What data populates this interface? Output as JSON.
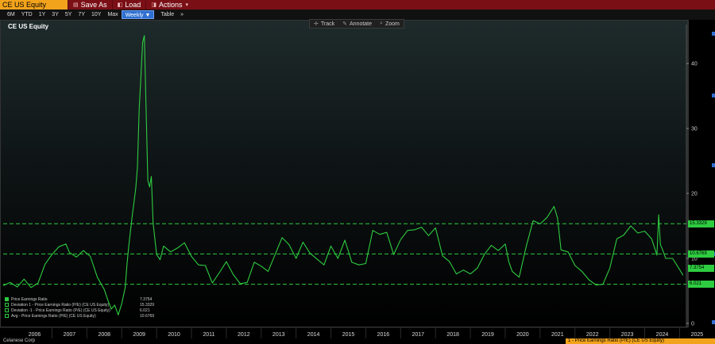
{
  "topbar": {
    "ticker": "CE US Equity",
    "save_as": "Save As",
    "load": "Load",
    "actions": "Actions"
  },
  "rangebar": {
    "buttons": [
      "6M",
      "YTD",
      "1Y",
      "3Y",
      "5Y",
      "7Y",
      "10Y",
      "Max"
    ],
    "periodicity": "Weekly ▼",
    "table": "Table",
    "more": "»"
  },
  "chart_tools": {
    "track": "Track",
    "annotate": "Annotate",
    "zoom": "Zoom"
  },
  "colors": {
    "line": "#2ecc40",
    "bar": "#7a0f16",
    "accent": "#f2a31c",
    "selected": "#2f6fd1"
  },
  "icons": {
    "save_as": "save-icon",
    "load": "load-icon",
    "actions": "actions-icon",
    "track": "crosshair-icon",
    "annotate": "pencil-icon",
    "zoom": "magnifier-icon"
  },
  "footer": {
    "company": "Celanese Corp",
    "tab": "1 - Price Earnings Ratio (P/E) (CE US Equity)"
  },
  "chart_data": {
    "type": "line",
    "title": "CE US Equity",
    "x_labels": [
      "2006",
      "2007",
      "2008",
      "2009",
      "2010",
      "2011",
      "2012",
      "2013",
      "2014",
      "2015",
      "2016",
      "2017",
      "2018",
      "2019",
      "2020",
      "2021",
      "2022",
      "2023",
      "2024",
      "2025"
    ],
    "y_ticks": [
      0,
      10,
      20,
      30,
      40
    ],
    "ylim": [
      -0.5,
      46
    ],
    "grid": false,
    "legend_position": "bottom-left",
    "legend": [
      {
        "name": "Price Earnings Ratio",
        "value": "7.3754",
        "filled": true
      },
      {
        "name": "Deviation 1 - Price Earnings Ratio (P/E) (CE US Equity)",
        "value": "15.3329",
        "filled": false
      },
      {
        "name": "Deviation -1 - Price Earnings Ratio (P/E) (CE US Equity)",
        "value": "6.021",
        "filled": false
      },
      {
        "name": "Avg - Price Earnings Ratio (P/E) (CE US Equity)",
        "value": "10.6769",
        "filled": false
      }
    ],
    "reference_lines": [
      {
        "name": "Deviation 1",
        "value": 15.3329,
        "label": "15.3329"
      },
      {
        "name": "Avg",
        "value": 10.6769,
        "label": "10.6769"
      },
      {
        "name": "Deviation -1",
        "value": 6.021,
        "label": "6.021"
      }
    ],
    "last_value": {
      "value": 7.3754,
      "label": "7.3754"
    },
    "series": [
      {
        "name": "Price Earnings Ratio",
        "x": [
          2005.6,
          2005.8,
          2006.0,
          2006.2,
          2006.4,
          2006.6,
          2006.8,
          2007.0,
          2007.2,
          2007.4,
          2007.5,
          2007.7,
          2007.9,
          2008.1,
          2008.3,
          2008.5,
          2008.6,
          2008.7,
          2008.8,
          2008.9,
          2009.0,
          2009.1,
          2009.15,
          2009.2,
          2009.3,
          2009.4,
          2009.45,
          2009.5,
          2009.55,
          2009.6,
          2009.65,
          2009.7,
          2009.75,
          2009.8,
          2009.85,
          2009.9,
          2010.0,
          2010.1,
          2010.2,
          2010.4,
          2010.6,
          2010.8,
          2011.0,
          2011.2,
          2011.4,
          2011.6,
          2011.8,
          2012.0,
          2012.2,
          2012.4,
          2012.6,
          2012.8,
          2013.0,
          2013.2,
          2013.4,
          2013.6,
          2013.8,
          2014.0,
          2014.2,
          2014.4,
          2014.6,
          2014.8,
          2015.0,
          2015.2,
          2015.4,
          2015.6,
          2015.8,
          2016.0,
          2016.2,
          2016.4,
          2016.6,
          2016.8,
          2017.0,
          2017.2,
          2017.4,
          2017.6,
          2017.8,
          2018.0,
          2018.2,
          2018.4,
          2018.6,
          2018.8,
          2019.0,
          2019.2,
          2019.4,
          2019.6,
          2019.8,
          2020.0,
          2020.1,
          2020.2,
          2020.4,
          2020.6,
          2020.8,
          2021.0,
          2021.2,
          2021.4,
          2021.5,
          2021.6,
          2021.8,
          2022.0,
          2022.2,
          2022.4,
          2022.6,
          2022.8,
          2023.0,
          2023.2,
          2023.4,
          2023.6,
          2023.8,
          2024.0,
          2024.2,
          2024.35,
          2024.4,
          2024.45,
          2024.5,
          2024.6,
          2024.8,
          2025.0,
          2025.1
        ],
        "values": [
          5.8,
          6.3,
          5.6,
          6.8,
          5.5,
          6.2,
          9.1,
          10.6,
          11.8,
          12.2,
          10.9,
          10.2,
          11.2,
          10.3,
          7.1,
          5.2,
          3.6,
          2.2,
          2.8,
          1.3,
          3.0,
          5.5,
          9.0,
          11.8,
          16.5,
          20.7,
          24.0,
          33.0,
          38.0,
          43.2,
          44.3,
          33.0,
          22.0,
          21.0,
          22.6,
          15.5,
          10.6,
          9.8,
          11.9,
          11.0,
          11.6,
          12.4,
          10.3,
          9.0,
          8.9,
          6.2,
          7.8,
          9.5,
          7.5,
          6.1,
          6.3,
          9.4,
          8.8,
          8.0,
          10.6,
          13.2,
          12.1,
          10.0,
          12.5,
          10.8,
          9.9,
          9.0,
          11.9,
          10.0,
          12.8,
          9.4,
          9.0,
          9.2,
          14.3,
          13.7,
          14.0,
          10.6,
          12.9,
          14.3,
          14.4,
          14.8,
          13.5,
          14.7,
          10.4,
          9.5,
          7.6,
          8.2,
          7.6,
          8.5,
          10.6,
          12.0,
          11.2,
          12.2,
          9.5,
          8.0,
          7.1,
          11.8,
          15.8,
          15.3,
          16.3,
          18.0,
          16.2,
          11.3,
          11.0,
          8.9,
          8.0,
          6.7,
          5.9,
          6.0,
          8.5,
          13.0,
          13.6,
          15.0,
          13.9,
          14.2,
          13.0,
          10.5,
          16.7,
          12.1,
          11.5,
          10.0,
          10.0,
          8.3,
          7.4
        ]
      }
    ]
  }
}
